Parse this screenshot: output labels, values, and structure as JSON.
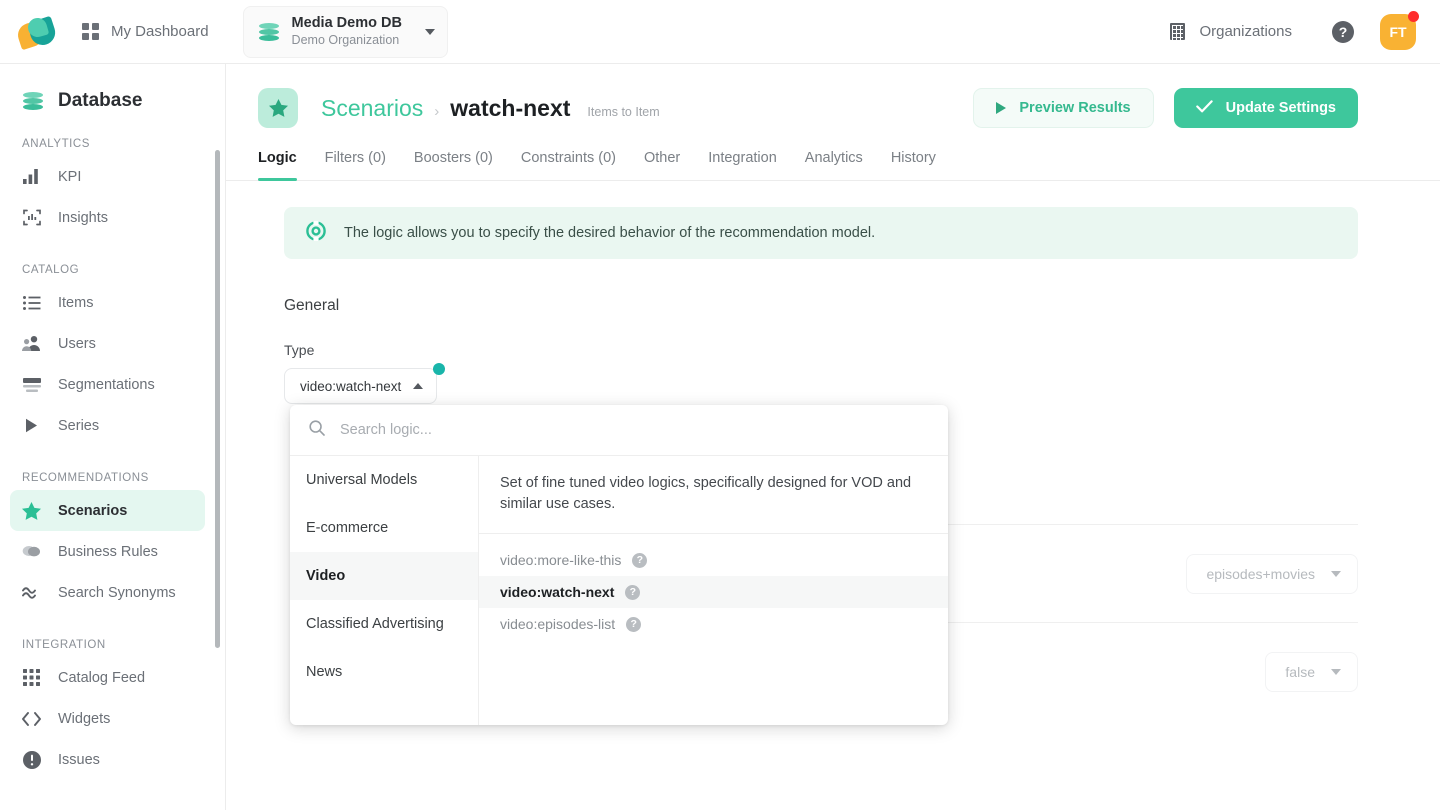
{
  "topbar": {
    "logo_icon": "recombee-logo-icon",
    "dashboard_label": "My Dashboard",
    "dashboard_icon": "grid-icon",
    "db_name": "Media Demo DB",
    "db_org": "Demo Organization",
    "db_icon": "database-icon",
    "db_caret_icon": "chevron-down-icon",
    "organizations_label": "Organizations",
    "organizations_icon": "building-icon",
    "help_label": "?",
    "avatar_initials": "FT"
  },
  "sidebar": {
    "title": "Database",
    "title_icon": "database-icon",
    "groups": [
      {
        "label": "ANALYTICS",
        "items": [
          {
            "label": "KPI",
            "icon": "bar-chart-icon",
            "active": false
          },
          {
            "label": "Insights",
            "icon": "insights-icon",
            "active": false
          }
        ]
      },
      {
        "label": "CATALOG",
        "items": [
          {
            "label": "Items",
            "icon": "list-icon",
            "active": false
          },
          {
            "label": "Users",
            "icon": "users-icon",
            "active": false
          },
          {
            "label": "Segmentations",
            "icon": "segmentations-icon",
            "active": false
          },
          {
            "label": "Series",
            "icon": "play-triangle-icon",
            "active": false
          }
        ]
      },
      {
        "label": "RECOMMENDATIONS",
        "items": [
          {
            "label": "Scenarios",
            "icon": "star-icon",
            "active": true
          },
          {
            "label": "Business Rules",
            "icon": "overlapping-circles-icon",
            "active": false
          },
          {
            "label": "Search Synonyms",
            "icon": "approx-equal-icon",
            "active": false
          }
        ]
      },
      {
        "label": "INTEGRATION",
        "items": [
          {
            "label": "Catalog Feed",
            "icon": "dots-grid-icon",
            "active": false
          },
          {
            "label": "Widgets",
            "icon": "code-brackets-icon",
            "active": false
          },
          {
            "label": "Issues",
            "icon": "exclamation-circle-icon",
            "active": false
          }
        ]
      }
    ]
  },
  "page": {
    "badge_icon": "star-icon",
    "breadcrumb_parent": "Scenarios",
    "breadcrumb_separator": "›",
    "breadcrumb_current": "watch-next",
    "breadcrumb_subtitle": "Items to Item",
    "preview_button": "Preview Results",
    "preview_icon": "play-icon",
    "update_button": "Update Settings",
    "update_icon": "check-icon",
    "tabs": [
      {
        "label": "Logic",
        "active": true
      },
      {
        "label": "Filters (0)",
        "active": false
      },
      {
        "label": "Boosters (0)",
        "active": false
      },
      {
        "label": "Constraints (0)",
        "active": false
      },
      {
        "label": "Other",
        "active": false
      },
      {
        "label": "Integration",
        "active": false
      },
      {
        "label": "Analytics",
        "active": false
      },
      {
        "label": "History",
        "active": false
      }
    ]
  },
  "logic": {
    "info_icon": "lifebuoy-icon",
    "info_text": "The logic allows you to specify the desired behavior of the recommendation model.",
    "section_title": "General",
    "type_label": "Type",
    "type_value": "video:watch-next",
    "type_caret_icon": "chevron-up-icon",
    "type_modified_dot": "modified-indicator-dot",
    "background_rows": [
      {
        "value": "episodes+movies",
        "caret_icon": "chevron-down-icon"
      },
      {
        "value": "false",
        "caret_icon": "chevron-down-icon"
      }
    ]
  },
  "dropdown": {
    "search_icon": "search-icon",
    "search_value": "",
    "search_placeholder": "Search logic...",
    "categories": [
      {
        "label": "Universal Models",
        "active": false
      },
      {
        "label": "E-commerce",
        "active": false
      },
      {
        "label": "Video",
        "active": true
      },
      {
        "label": "Classified Advertising",
        "active": false
      },
      {
        "label": "News",
        "active": false
      }
    ],
    "description": "Set of fine tuned video logics, specifically designed for VOD and similar use cases.",
    "options": [
      {
        "label": "video:more-like-this",
        "selected": false,
        "help_icon": "question-mark-icon"
      },
      {
        "label": "video:watch-next",
        "selected": true,
        "help_icon": "question-mark-icon"
      },
      {
        "label": "video:episodes-list",
        "selected": false,
        "help_icon": "question-mark-icon"
      }
    ]
  },
  "colors": {
    "accent_green": "#3ec79c",
    "accent_teal": "#19b5aa",
    "banner_bg": "#eaf7f1",
    "avatar_orange": "#f9b233",
    "notification_red": "#ff2d2d"
  }
}
